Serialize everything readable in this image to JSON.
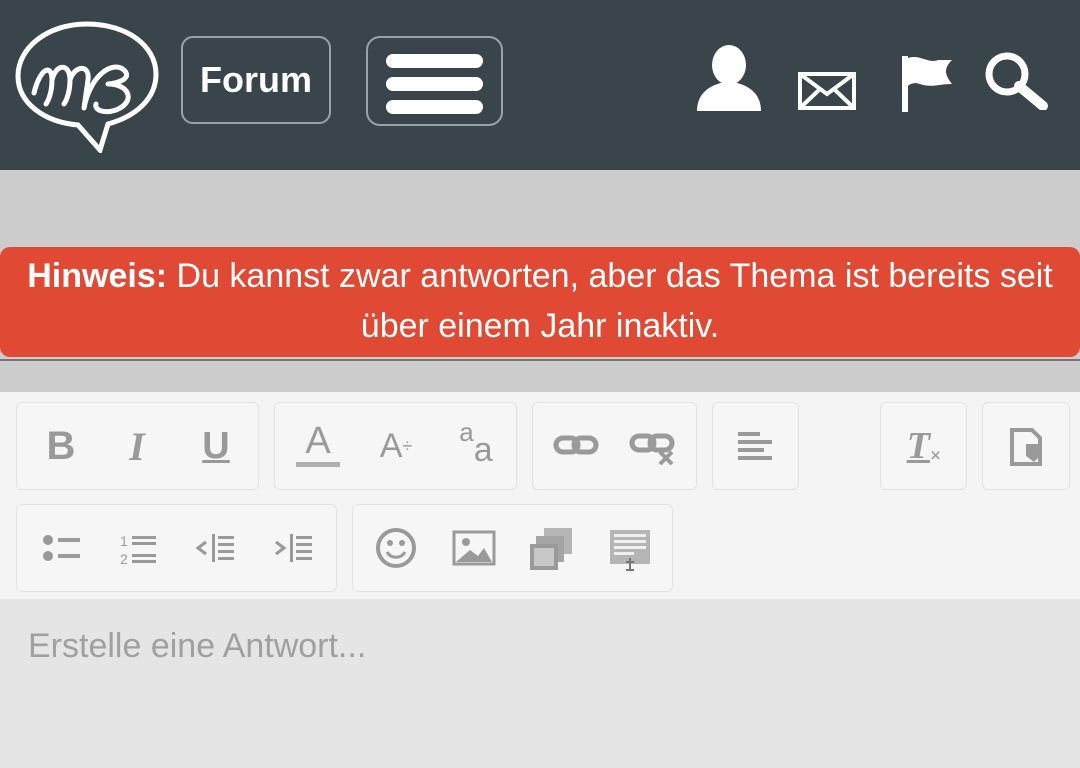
{
  "header": {
    "forum_label": "Forum",
    "icons": [
      "logo-icon",
      "menu-icon",
      "user-icon",
      "mail-icon",
      "flag-icon",
      "search-icon"
    ]
  },
  "notice": {
    "label": "Hinweis:",
    "text": " Du kannst zwar antworten, aber das Thema ist bereits seit über einem Jahr inaktiv."
  },
  "toolbar": {
    "bold": "B",
    "italic": "I",
    "underline": "U",
    "font_color": "A",
    "font_size": "A",
    "font_size_sub": "÷",
    "font_family_top": "a",
    "font_family_bottom": "a",
    "clear_format": "T"
  },
  "editor": {
    "placeholder": "Erstelle eine Antwort..."
  },
  "colors": {
    "header_bg": "#3a444b",
    "notice_bg": "#e04a34",
    "page_bg": "#cccccc"
  }
}
